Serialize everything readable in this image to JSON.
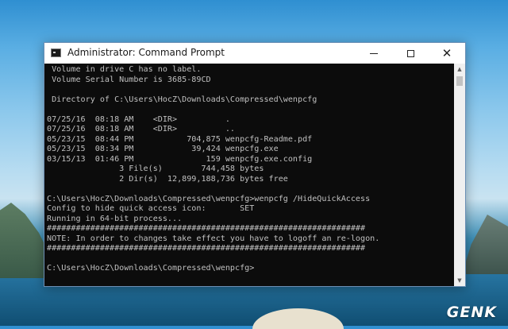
{
  "window": {
    "title": "Administrator: Command Prompt",
    "icon": "cmd-icon",
    "controls": {
      "minimize": "minimize-icon",
      "maximize": "maximize-icon",
      "close": "✕"
    }
  },
  "console": {
    "lines": [
      " Volume in drive C has no label.",
      " Volume Serial Number is 3685-89CD",
      "",
      " Directory of C:\\Users\\HocZ\\Downloads\\Compressed\\wenpcfg",
      "",
      "07/25/16  08:18 AM    <DIR>          .",
      "07/25/16  08:18 AM    <DIR>          ..",
      "05/23/15  08:44 PM           704,875 wenpcfg-Readme.pdf",
      "05/23/15  08:34 PM            39,424 wenpcfg.exe",
      "03/15/13  01:46 PM               159 wenpcfg.exe.config",
      "               3 File(s)        744,458 bytes",
      "               2 Dir(s)  12,899,188,736 bytes free",
      "",
      "C:\\Users\\HocZ\\Downloads\\Compressed\\wenpcfg>wenpcfg /HideQuickAccess",
      "Config to hide quick access icon:       SET",
      "Running in 64-bit process...",
      "##################################################################",
      "NOTE: In order to changes take effect you have to logoff an re-logon.",
      "##################################################################",
      "",
      "C:\\Users\\HocZ\\Downloads\\Compressed\\wenpcfg>"
    ]
  },
  "watermark": {
    "text": "GENK"
  },
  "colors": {
    "console_bg": "#0c0c0c",
    "console_fg": "#c0c0c0",
    "titlebar_bg": "#ffffff",
    "window_border": "#6b8fb5"
  }
}
